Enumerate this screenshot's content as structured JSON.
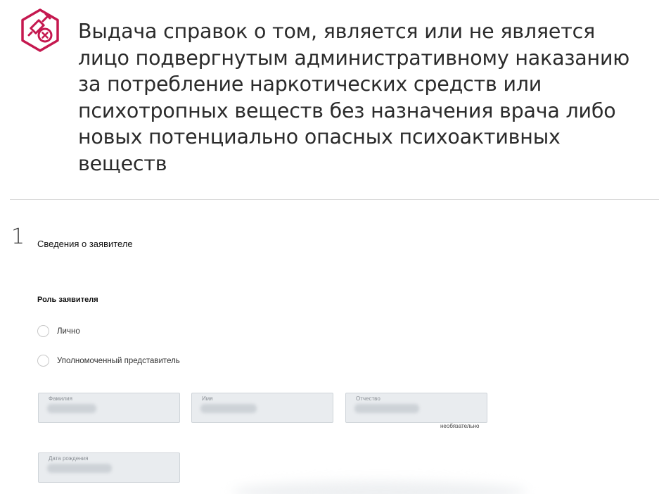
{
  "header": {
    "icon": "syringe-cross-icon",
    "accent_color": "#c5184f",
    "title": "Выдача справок о том, является или не является лицо подвергнутым административному наказанию за потребление наркотических средств или психотропных веществ без назначения врача либо новых потенциально опасных психоактивных веществ"
  },
  "step": {
    "number": "1",
    "title": "Сведения о заявителе"
  },
  "role": {
    "label": "Роль заявителя",
    "options": [
      {
        "label": "Лично",
        "selected": false
      },
      {
        "label": "Уполномоченный представитель",
        "selected": false
      }
    ]
  },
  "fields": {
    "surname": {
      "label": "Фамилия",
      "value": ""
    },
    "name": {
      "label": "Имя",
      "value": ""
    },
    "patronymic": {
      "label": "Отчество",
      "value": "",
      "note": "необязательно"
    },
    "birthdate": {
      "label": "Дата рождения",
      "value": ""
    }
  }
}
